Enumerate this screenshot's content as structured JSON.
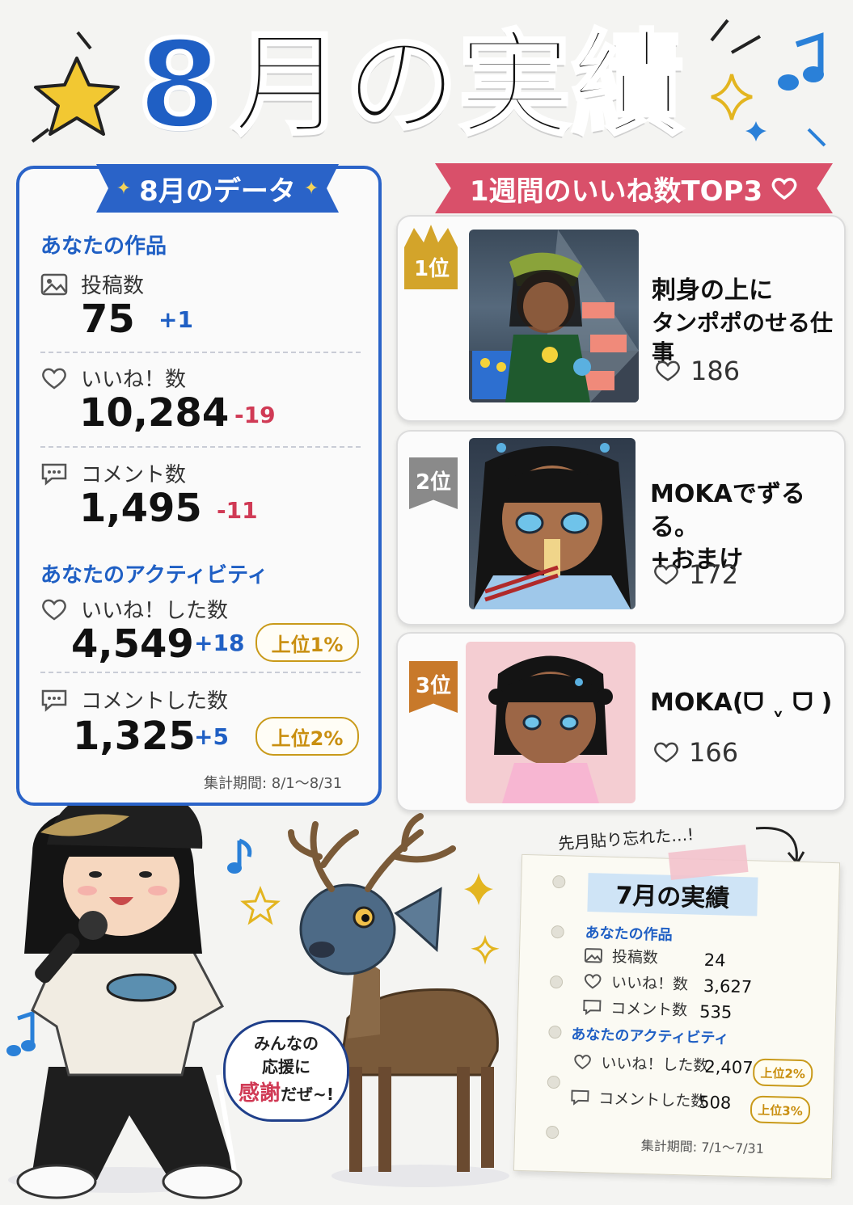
{
  "title": {
    "number": "8",
    "text": "月の実績"
  },
  "data_panel": {
    "ribbon": "8月のデータ",
    "works_head": "あなたの作品",
    "posts": {
      "label": "投稿数",
      "value": "75",
      "delta": "+1"
    },
    "likes": {
      "label": "いいね！数",
      "value": "10,284",
      "delta": "-19"
    },
    "comments": {
      "label": "コメント数",
      "value": "1,495",
      "delta": "-11"
    },
    "activity_head": "あなたのアクティビティ",
    "liked": {
      "label": "いいね！した数",
      "value": "4,549",
      "delta": "+18",
      "rank": "上位1%"
    },
    "commented": {
      "label": "コメントした数",
      "value": "1,325",
      "delta": "+5",
      "rank": "上位2%"
    },
    "period": "集計期間: 8/1～8/31"
  },
  "top3": {
    "ribbon": "1週間のいいね数TOP3",
    "items": [
      {
        "rank": "1位",
        "title_line1": "刺身の上に",
        "title_line2": "タンポポのせる仕事",
        "likes": "186"
      },
      {
        "rank": "2位",
        "title_line1": "MOKAでずるる。",
        "title_line2": "+おまけ",
        "likes": "172"
      },
      {
        "rank": "3位",
        "title_line1": "MOKA(ᗜ ˬ ᗜ )",
        "title_line2": "",
        "likes": "166"
      }
    ]
  },
  "bubble": {
    "line1": "みんなの",
    "line2": "応援に",
    "emph": "感謝",
    "tail": "だぜ~!"
  },
  "july_note": {
    "handwrite": "先月貼り忘れた…!",
    "title": "7月の実績",
    "works_head": "あなたの作品",
    "posts": {
      "label": "投稿数",
      "value": "24"
    },
    "likes": {
      "label": "いいね！数",
      "value": "3,627"
    },
    "comments": {
      "label": "コメント数",
      "value": "535"
    },
    "activity_head": "あなたのアクティビティ",
    "liked": {
      "label": "いいね！した数",
      "value": "2,407",
      "rank": "上位2%"
    },
    "commented": {
      "label": "コメントした数",
      "value": "508",
      "rank": "上位3%"
    },
    "period": "集計期間: 7/1～7/31"
  },
  "colors": {
    "blue": "#2a63c8",
    "pink": "#d9506a",
    "gold": "#c99a1a"
  }
}
